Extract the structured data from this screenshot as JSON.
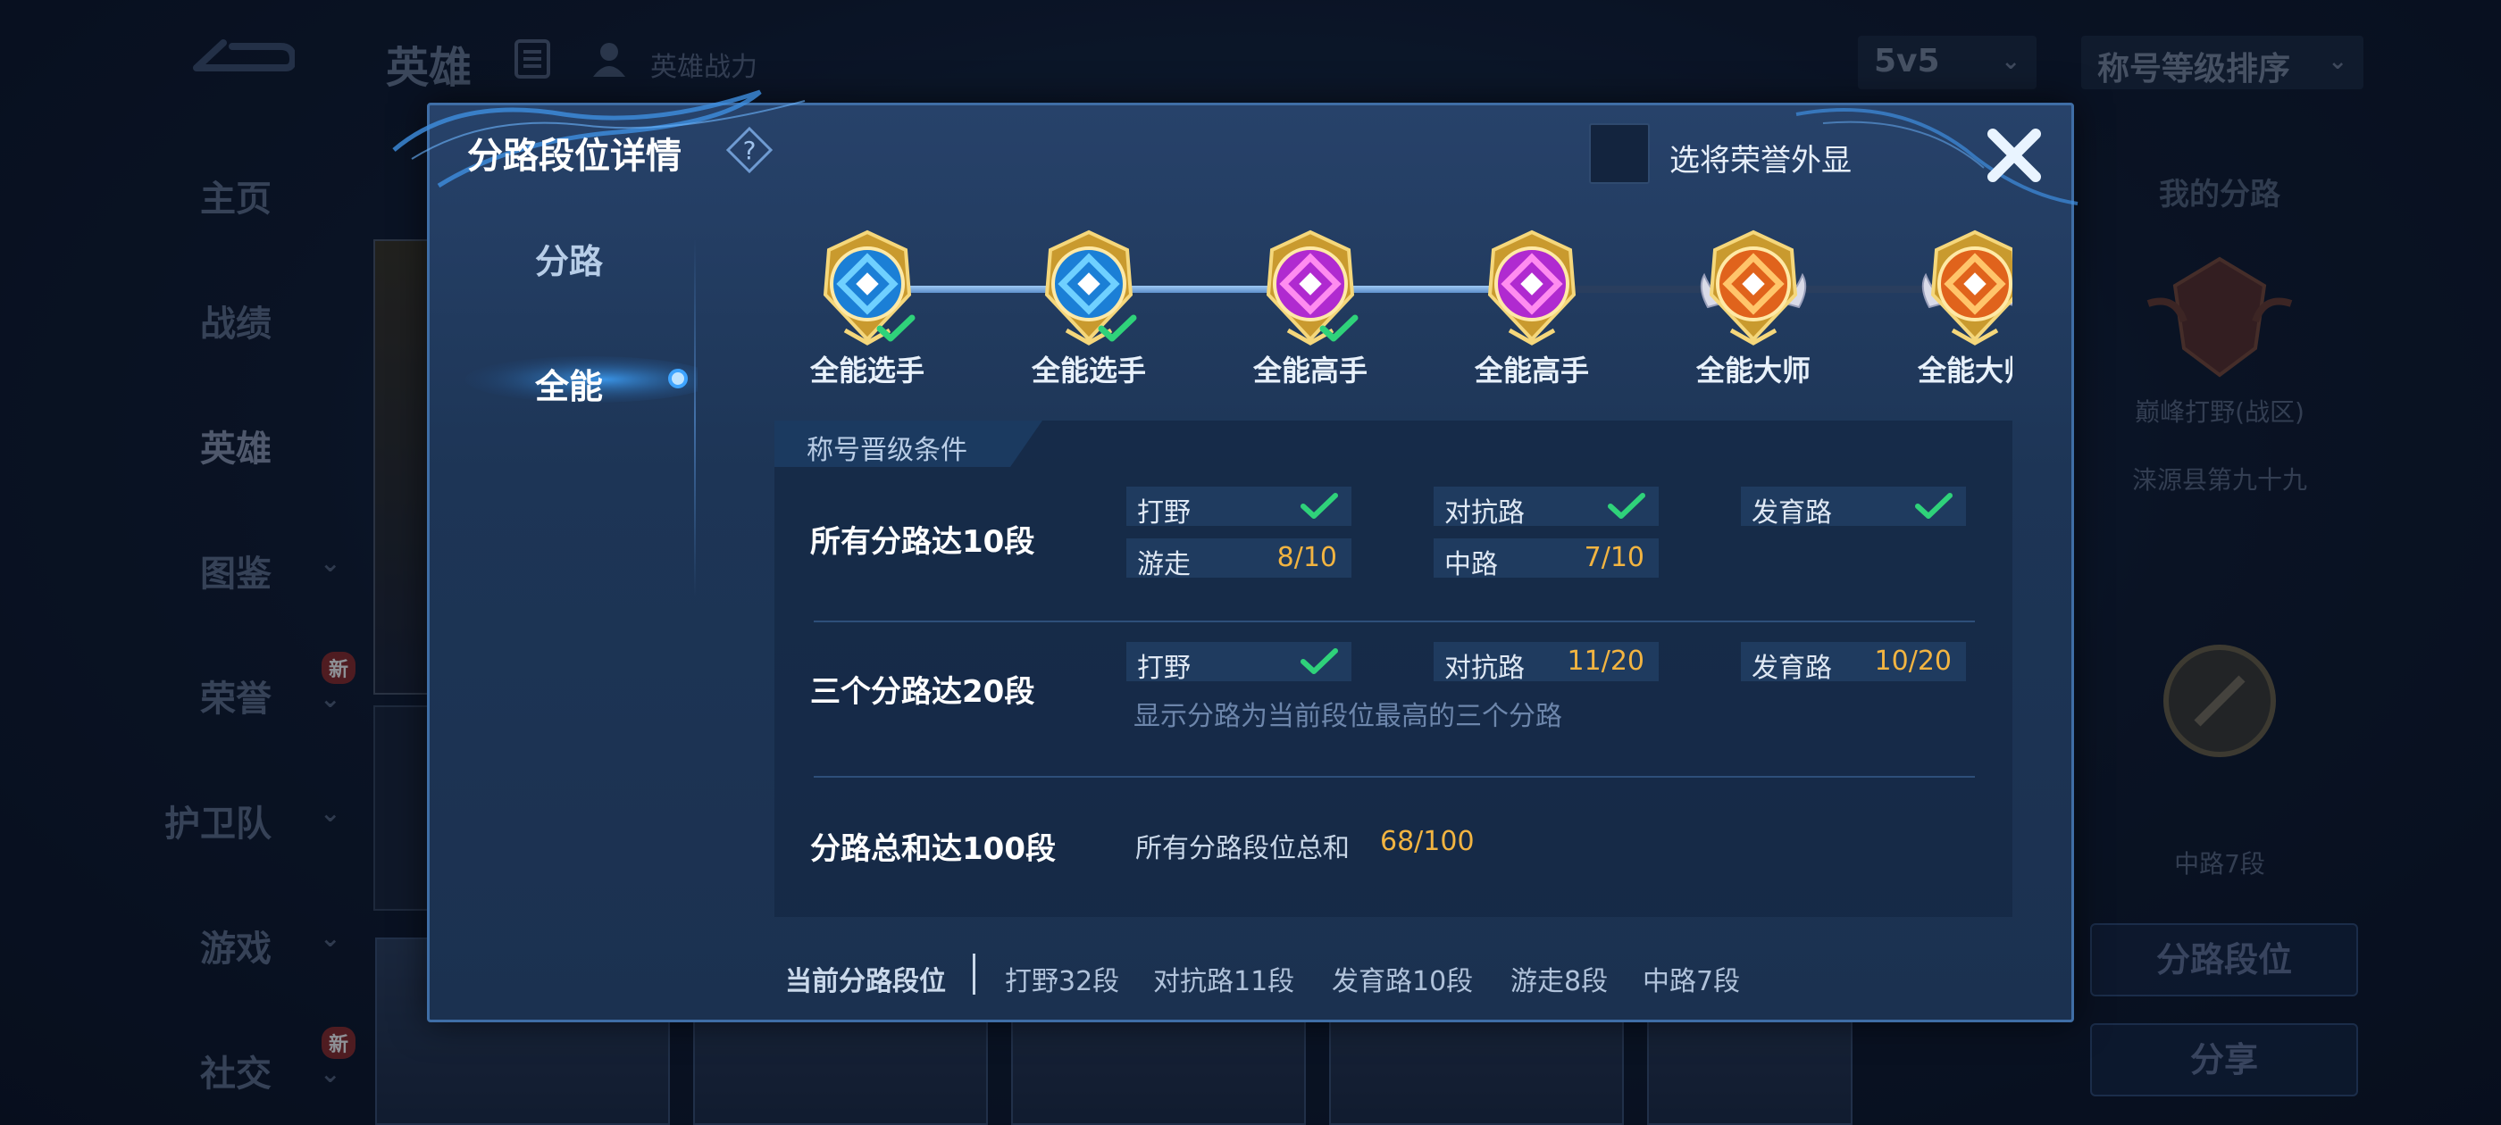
{
  "background": {
    "top_title": "英雄",
    "top_sub": "英雄战力",
    "mode_select": "5v5",
    "sort_select": "称号等级排序",
    "nav": [
      {
        "label": "主页",
        "chevron": false,
        "badge": ""
      },
      {
        "label": "战绩",
        "chevron": false,
        "badge": ""
      },
      {
        "label": "英雄",
        "chevron": false,
        "badge": ""
      },
      {
        "label": "图鉴",
        "chevron": true,
        "badge": ""
      },
      {
        "label": "荣誉",
        "chevron": true,
        "badge": "新"
      },
      {
        "label": "护卫队",
        "chevron": true,
        "badge": ""
      },
      {
        "label": "游戏",
        "chevron": true,
        "badge": ""
      },
      {
        "label": "社交",
        "chevron": true,
        "badge": "新"
      }
    ],
    "right_panel": {
      "title": "我的分路",
      "role_title": "巅峰打野(战区)",
      "region": "涞源县第九十九",
      "lane_rank": "中路7段",
      "lane_button": "分路段位",
      "share_button": "分享"
    }
  },
  "modal": {
    "title": "分路段位详情",
    "display_toggle_label": "选将荣誉外显",
    "tabs": [
      {
        "label": "分路",
        "active": false
      },
      {
        "label": "全能",
        "active": true
      }
    ],
    "ranks": [
      {
        "label": "全能选手",
        "tier": "blue",
        "achieved": true
      },
      {
        "label": "全能选手",
        "tier": "blue",
        "achieved": true
      },
      {
        "label": "全能高手",
        "tier": "purple",
        "achieved": true
      },
      {
        "label": "全能高手",
        "tier": "purple",
        "achieved": false
      },
      {
        "label": "全能大师",
        "tier": "orange",
        "achieved": false
      },
      {
        "label": "全能大师",
        "tier": "orange",
        "achieved": false
      }
    ],
    "conditions": {
      "header": "称号晋级条件",
      "rows": [
        {
          "title": "所有分路达10段",
          "items": [
            {
              "name": "打野",
              "value": "",
              "done": true
            },
            {
              "name": "对抗路",
              "value": "",
              "done": true
            },
            {
              "name": "发育路",
              "value": "",
              "done": true
            },
            {
              "name": "游走",
              "value": "8/10",
              "done": false
            },
            {
              "name": "中路",
              "value": "7/10",
              "done": false
            }
          ]
        },
        {
          "title": "三个分路达20段",
          "items": [
            {
              "name": "打野",
              "value": "",
              "done": true
            },
            {
              "name": "对抗路",
              "value": "11/20",
              "done": false
            },
            {
              "name": "发育路",
              "value": "10/20",
              "done": false
            }
          ],
          "note": "显示分路为当前段位最高的三个分路"
        },
        {
          "title": "分路总和达100段",
          "summary_label": "所有分路段位总和",
          "summary_value": "68/100"
        }
      ]
    },
    "footer": {
      "label": "当前分路段位",
      "items": [
        "打野32段",
        "对抗路11段",
        "发育路10段",
        "游走8段",
        "中路7段"
      ]
    },
    "colors": {
      "accent_gold": "#f2b441",
      "check_green": "#2fd27a",
      "modal_bg": "#1d3556"
    }
  }
}
